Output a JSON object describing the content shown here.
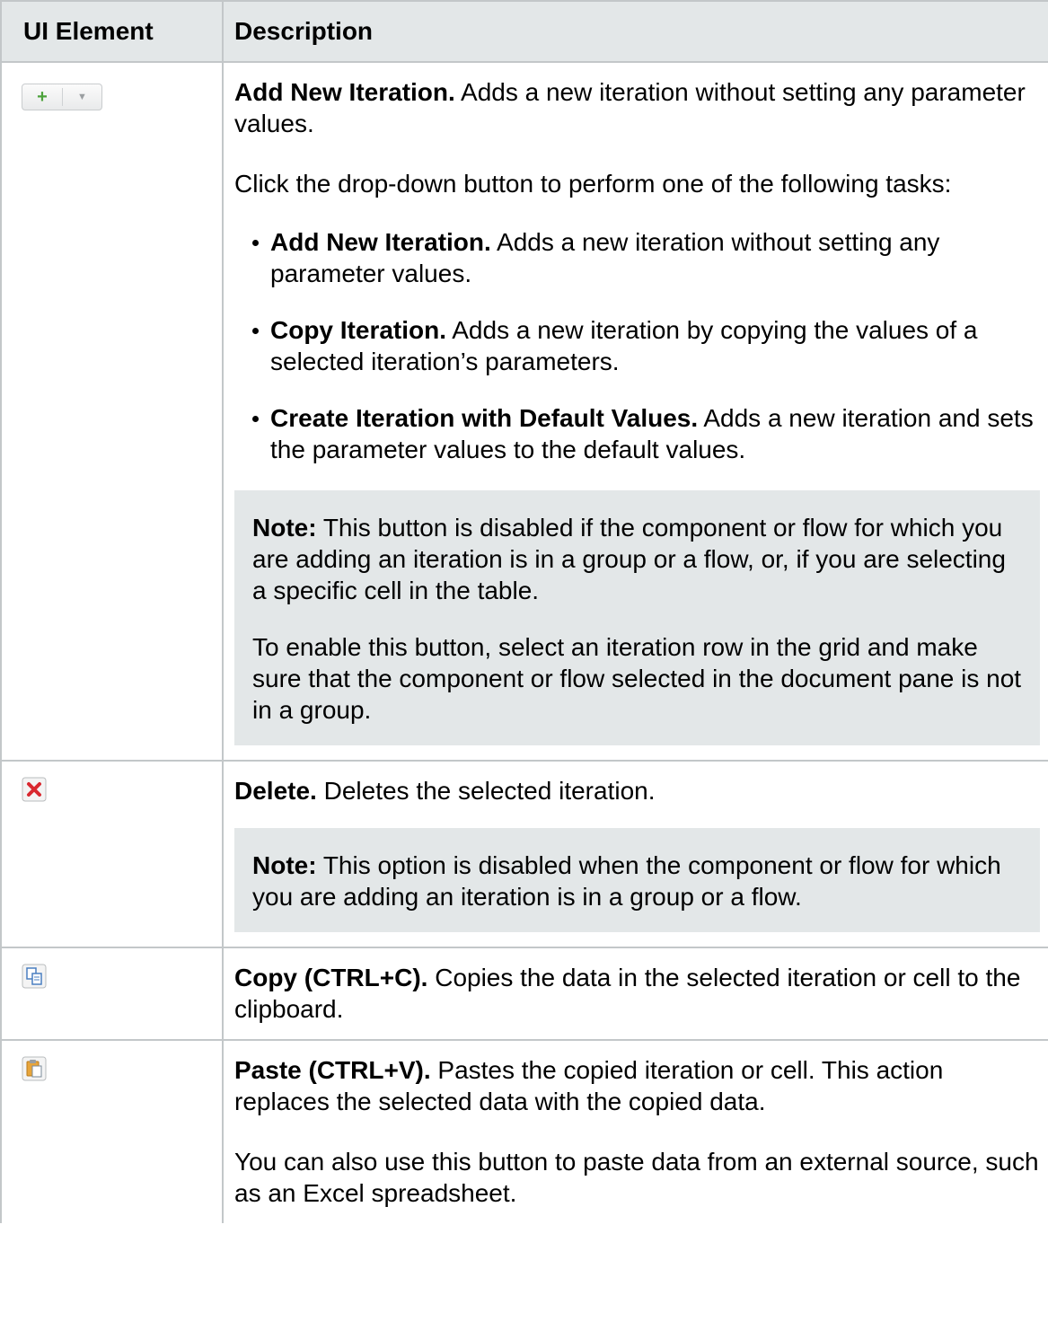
{
  "table": {
    "headers": [
      "UI Element",
      "Description"
    ],
    "rows": [
      {
        "icon": "add-iteration-split-button-icon",
        "title": "Add New Iteration.",
        "text": " Adds a new iteration without setting any parameter values.",
        "para2": "Click the drop-down button to perform one of the following tasks:",
        "bullets": [
          {
            "title": "Add New Iteration.",
            "text": " Adds a new iteration without setting any parameter values."
          },
          {
            "title": "Copy Iteration.",
            "text": " Adds a new iteration by copying the values of a selected iteration’s parameters."
          },
          {
            "title": "Create Iteration with Default Values.",
            "text": " Adds a new iteration and sets the parameter values to the default values."
          }
        ],
        "note": {
          "label": "Note:",
          "text": " This button is disabled if the component or flow for which you are adding an iteration is in a group or a flow, or, if you are selecting a specific cell in the table.",
          "para2": "To enable this button, select an iteration row in the grid and make sure that the component or flow selected in the document pane is not in a group."
        }
      },
      {
        "icon": "delete-icon",
        "title": "Delete.",
        "text": " Deletes the selected iteration.",
        "note": {
          "label": "Note:",
          "text": " This option is disabled when the component or flow for which you are adding an iteration is in a group or a flow."
        }
      },
      {
        "icon": "copy-icon",
        "title": "Copy (CTRL+C).",
        "text": " Copies the data in the selected iteration or cell to the clipboard."
      },
      {
        "icon": "paste-icon",
        "title": "Paste (CTRL+V).",
        "text": " Pastes the copied iteration or cell. This action replaces the selected data with the copied data.",
        "para2": "You can also use this button to paste data from an external source, such as an Excel spreadsheet."
      }
    ]
  },
  "colors": {
    "header_bg": "#e3e7e8",
    "note_bg": "#e3e7e8",
    "border": "#c3c7c9",
    "plus_green": "#4ca23b",
    "delete_red": "#d9282f"
  }
}
